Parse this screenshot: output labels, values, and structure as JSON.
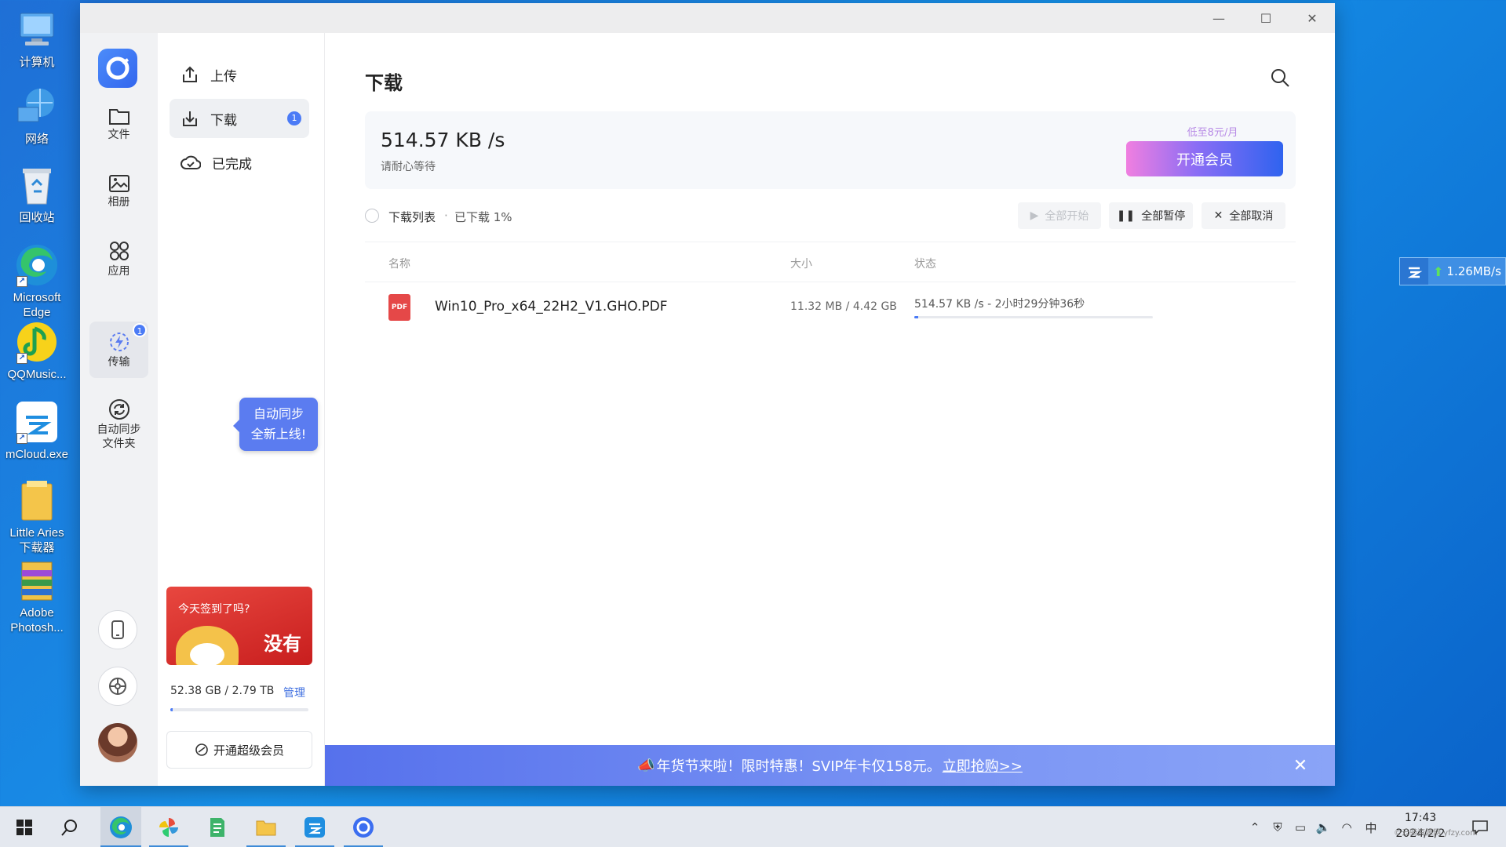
{
  "desktop": {
    "icons": [
      {
        "label": "计算机",
        "icon": "computer-icon"
      },
      {
        "label": "网络",
        "icon": "network-icon"
      },
      {
        "label": "回收站",
        "icon": "recycle-bin-icon"
      },
      {
        "label_line1": "Microsoft",
        "label_line2": "Edge",
        "icon": "edge-icon"
      },
      {
        "label": "QQMusic...",
        "icon": "qqmusic-icon"
      },
      {
        "label": "mCloud.exe",
        "icon": "mcloud-icon"
      },
      {
        "label_line1": "Little Aries",
        "label_line2": "下载器",
        "icon": "folder-icon"
      },
      {
        "label_line1": "Adobe",
        "label_line2": "Photosh...",
        "icon": "winrar-icon"
      }
    ]
  },
  "window": {
    "controls": {
      "minimize": "—",
      "maximize": "☐",
      "close": "✕"
    }
  },
  "rail": {
    "items": [
      {
        "label": "文件",
        "icon": "folder-icon"
      },
      {
        "label": "相册",
        "icon": "photo-album-icon"
      },
      {
        "label": "应用",
        "icon": "apps-icon"
      },
      {
        "label": "传输",
        "icon": "transfer-icon",
        "badge": "1"
      },
      {
        "label_line1": "自动同步",
        "label_line2": "文件夹",
        "icon": "sync-icon"
      }
    ],
    "tooltip_line1": "自动同步",
    "tooltip_line2": "全新上线!"
  },
  "subnav": {
    "items": [
      {
        "label": "上传",
        "icon": "upload-icon"
      },
      {
        "label": "下载",
        "icon": "download-icon",
        "badge": "1"
      },
      {
        "label": "已完成",
        "icon": "cloud-done-icon"
      }
    ],
    "signin": {
      "question": "今天签到了吗?",
      "answer": "没有"
    },
    "storage": {
      "text": "52.38 GB / 2.79 TB",
      "manage": "管理",
      "used_fraction": 0.018
    },
    "svip_label": "开通超级会员"
  },
  "main": {
    "title": "下载",
    "speed": {
      "value": "514.57 KB /s",
      "subtitle": "请耐心等待"
    },
    "vip": {
      "tip": "低至8元/月",
      "button": "开通会员"
    },
    "toolbar": {
      "list_label": "下载列表",
      "separator": "·",
      "progress_label": "已下载 1%",
      "start_all": "全部开始",
      "pause_all": "全部暂停",
      "cancel_all": "全部取消"
    },
    "columns": {
      "name": "名称",
      "size": "大小",
      "status": "状态"
    },
    "rows": [
      {
        "icon_label": "PDF",
        "name": "Win10_Pro_x64_22H2_V1.GHO.PDF",
        "size": "11.32 MB / 4.42 GB",
        "status": "514.57 KB /s - 2小时29分钟36秒",
        "progress_fraction": 0.0025
      }
    ],
    "promo": {
      "text": "年货节来啦！限时特惠！SVIP年卡仅158元。",
      "link": "立即抢购>>"
    }
  },
  "float_widget": {
    "speed": "1.26MB/s"
  },
  "taskbar": {
    "ime": "中",
    "time": "17:43",
    "date": "2024/2/2",
    "watermark": "©云骑资源网 yfzy.com"
  },
  "colors": {
    "accent": "#4b7bf6",
    "promo": "#5671ec",
    "signin": "#d9302c"
  }
}
